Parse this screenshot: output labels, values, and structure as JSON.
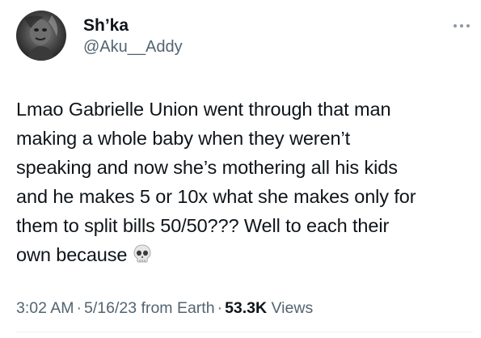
{
  "author": {
    "display_name": "Sh’ka",
    "handle": "@Aku__Addy",
    "avatar_icon": "profile-photo"
  },
  "more_icon": "more-horizontal-icon",
  "tweet": {
    "lines": [
      "Lmao Gabrielle Union went through that man",
      "making a whole baby when they weren’t",
      "speaking and now she’s mothering all his kids",
      "and he makes 5 or 10x what she makes only for",
      "them to split bills 50/50??? Well to each their",
      "own because"
    ],
    "emoji": "skull-emoji"
  },
  "meta": {
    "time": "3:02 AM",
    "date": "5/16/23",
    "source": "from Earth",
    "views_count": "53.3K",
    "views_label": "Views",
    "separator": "·"
  },
  "colors": {
    "text_primary": "#0f1419",
    "text_secondary": "#536471",
    "divider": "#eff3f4"
  }
}
